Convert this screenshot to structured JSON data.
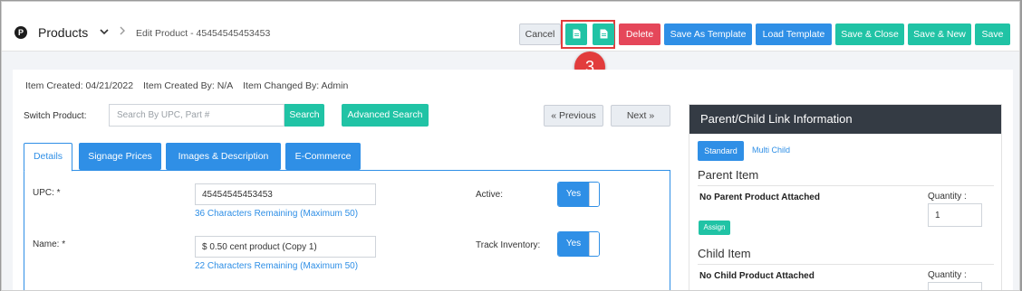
{
  "header": {
    "logo_letter": "P",
    "title": "Products",
    "breadcrumb": "Edit Product - 45454545453453"
  },
  "toolbar": {
    "cancel": "Cancel",
    "delete": "Delete",
    "save_as_template": "Save As Template",
    "load_template": "Load Template",
    "save_close": "Save & Close",
    "save_new": "Save & New",
    "save": "Save",
    "callout_number": "3"
  },
  "meta": {
    "created": "Item Created: 04/21/2022",
    "created_by": "Item Created By: N/A",
    "changed_by": "Item Changed By: Admin"
  },
  "switch": {
    "label": "Switch Product:",
    "placeholder": "Search By UPC, Part #",
    "search": "Search",
    "advanced": "Advanced Search",
    "previous": "« Previous",
    "next": "Next »"
  },
  "tabs": [
    "Details",
    "Signage Prices",
    "Images & Description",
    "E-Commerce"
  ],
  "form": {
    "upc_label": "UPC: *",
    "upc_value": "45454545453453",
    "upc_hint": "36 Characters Remaining (Maximum 50)",
    "name_label": "Name: *",
    "name_value": "$ 0.50 cent product (Copy 1)",
    "name_hint": "22 Characters Remaining (Maximum 50)",
    "active_label": "Active:",
    "active_value": "Yes",
    "track_label": "Track Inventory:",
    "track_value": "Yes"
  },
  "link_panel": {
    "title": "Parent/Child Link Information",
    "standard": "Standard",
    "multi_child": "Multi Child",
    "parent_title": "Parent Item",
    "no_parent": "No Parent Product Attached",
    "quantity_label": "Quantity :",
    "parent_qty": "1",
    "assign": "Assign",
    "child_title": "Child Item",
    "no_child": "No Child Product Attached"
  },
  "colors": {
    "teal": "#20c3a5",
    "blue": "#2f8fe6",
    "red": "#e5475a",
    "callout": "#e23c3c",
    "panel_header": "#343b44"
  },
  "icons": {
    "logo": "p-logo-icon",
    "title_menu": "chevron-down-icon",
    "breadcrumb_sep": "chevron-right-icon",
    "doc1": "document-icon",
    "doc2": "document-icon"
  }
}
